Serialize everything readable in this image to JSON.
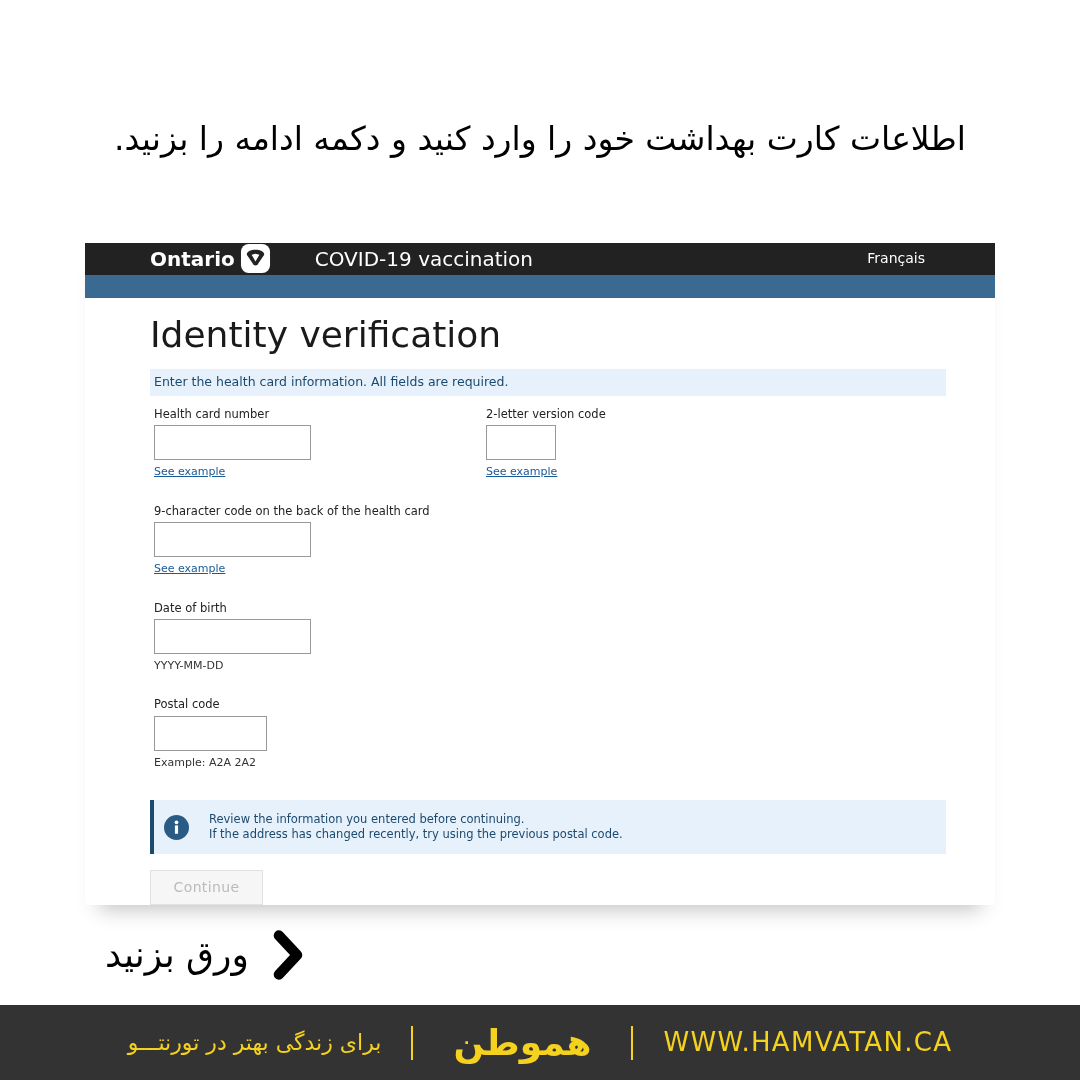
{
  "headline": "اطلاعات کارت بهداشت خود را وارد کنید و دکمه ادامه را بزنید.",
  "site": {
    "brand": "Ontario",
    "title": "COVID-19 vaccination",
    "language_link": "Français"
  },
  "page_title": "Identity verification",
  "instructions": "Enter the health card information. All fields are required.",
  "field_rows": [
    [
      {
        "label": "Health card number",
        "note": {
          "kind": "link",
          "text": "See example"
        }
      },
      {
        "label": "2-letter version code",
        "note": {
          "kind": "link",
          "text": "See example"
        }
      }
    ],
    [
      {
        "label": "9-character code on the back of the health card",
        "note": {
          "kind": "link",
          "text": "See example"
        }
      }
    ],
    [
      {
        "label": "Date of birth",
        "note": {
          "kind": "hint",
          "text": "YYYY-MM-DD"
        }
      }
    ],
    [
      {
        "label": "Postal code",
        "note": {
          "kind": "hint",
          "text": "Example: A2A 2A2"
        }
      }
    ]
  ],
  "notice": {
    "lines": [
      "Review the information you entered before continuing.",
      "If the address has changed recently, try using the previous postal code."
    ]
  },
  "continue_button": {
    "label": "Continue",
    "disabled": true
  },
  "swipe_hint": "ورق بزنید",
  "footer": {
    "tagline": "برای زندگی بهتر در تورنتـــو",
    "logo": "هموطن",
    "url": "WWW.HAMVATAN.CA"
  }
}
